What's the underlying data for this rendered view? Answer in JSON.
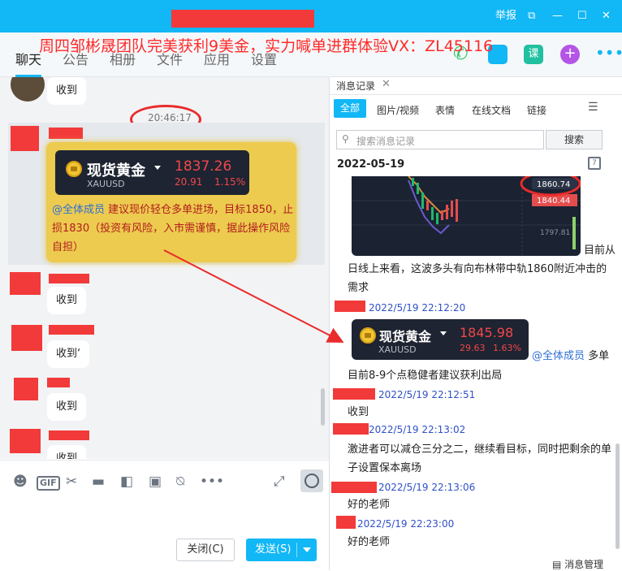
{
  "window": {
    "controls": [
      "举报",
      "⧉",
      "—",
      "☐",
      "✕"
    ]
  },
  "banner": "周四邹彬晟团队完美获利9美金，实力喊单进群体验VX：ZL45116",
  "tabs": [
    "聊天",
    "公告",
    "相册",
    "文件",
    "应用",
    "设置"
  ],
  "chat": {
    "top_bubble": "收到",
    "timestamp": "20:46:17",
    "gold_card": {
      "name": "现货黄金",
      "symbol": "XAUUSD",
      "price": "1837.26",
      "change": "20.91",
      "pct": "1.15%"
    },
    "mention": "@全体成员",
    "msg_text": " 建议现价轻仓多单进场，目标1850，止损1830（投资有风险，入市需谨慎，据此操作风险自担）",
    "replies": [
      "收到",
      "收到‘",
      "收到",
      "收到"
    ]
  },
  "buttons": {
    "close": "关闭(C)",
    "send": "发送(S)"
  },
  "history": {
    "tab": "消息记录",
    "filters": [
      "全部",
      "图片/视频",
      "表情",
      "在线文档",
      "链接"
    ],
    "search_placeholder": "搜索消息记录",
    "search_button": "搜索",
    "date": "2022-05-19",
    "chart_labels": [
      "1860.74",
      "1840.44",
      "1797.81"
    ],
    "chart_suffix": "目前从",
    "msg1": "日线上来看，这波多头有向布林带中轨1860附近冲击的需求",
    "time1": "2022/5/19 22:12:20",
    "gold_card": {
      "name": "现货黄金",
      "symbol": "XAUUSD",
      "price": "1845.98",
      "change": "29.63",
      "pct": "1.63%"
    },
    "mention": "@全体成员",
    "mention_suffix": " 多单",
    "msg2": "目前8-9个点稳健者建议获利出局",
    "time2": "2022/5/19 22:12:51",
    "msg3": "收到",
    "time3": "2022/5/19 22:13:02",
    "msg4": "激进者可以减仓三分之二，继续看目标，同时把剩余的单子设置保本离场",
    "time4": "2022/5/19 22:13:06",
    "msg5": "好的老师",
    "time5": "2022/5/19 22:23:00",
    "msg6": "好的老师",
    "footer": "消息管理"
  }
}
